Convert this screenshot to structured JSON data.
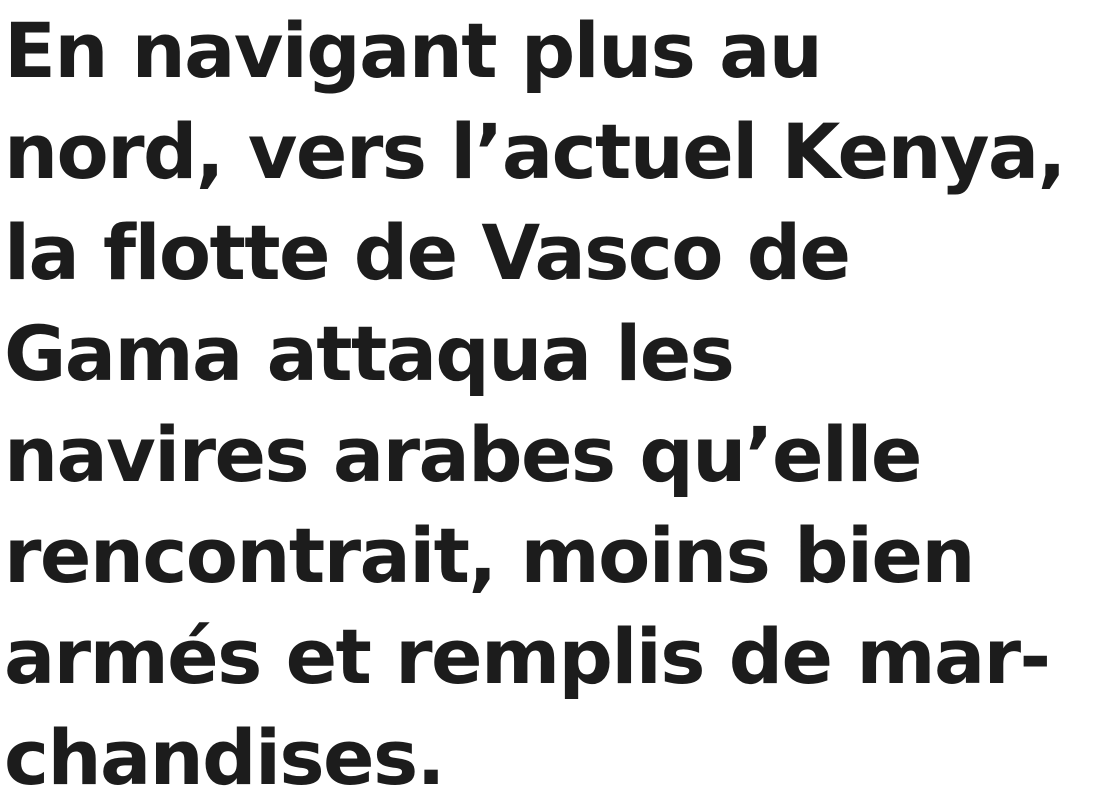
{
  "paragraph": {
    "lines": [
      "En navigant plus au",
      "nord, vers l’actuel Kenya,",
      "la flotte de Vasco de",
      "Gama attaqua les",
      "navires arabes qu’elle",
      "rencontrait, moins bien",
      "armés et remplis de mar-",
      "chandises."
    ]
  },
  "colors": {
    "text": "#1c1c1c",
    "background": "#ffffff"
  }
}
